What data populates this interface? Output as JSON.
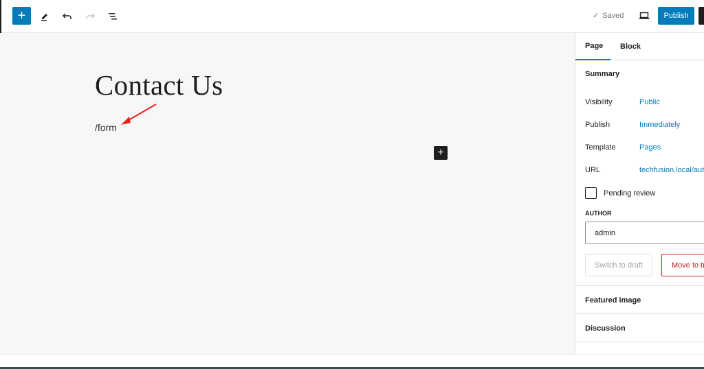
{
  "toolbar": {
    "inserter_icon": "plus-icon",
    "tools_icon": "pencil-icon",
    "undo_icon": "undo-icon",
    "redo_icon": "redo-icon",
    "outline_icon": "list-view-icon",
    "saved_label": "Saved",
    "preview_icon": "desktop-icon",
    "publish_label": "Publish"
  },
  "editor": {
    "title": "Contact Us",
    "paragraph": "/form",
    "annotation": "red-arrow",
    "block_add_icon": "plus-icon"
  },
  "sidebar": {
    "tabs": [
      {
        "label": "Page",
        "active": true
      },
      {
        "label": "Block",
        "active": false
      }
    ],
    "summary": {
      "title": "Summary",
      "rows": [
        {
          "label": "Visibility",
          "value": "Public"
        },
        {
          "label": "Publish",
          "value": "Immediately"
        },
        {
          "label": "Template",
          "value": "Pages"
        },
        {
          "label": "URL",
          "value": "techfusion.local/auto"
        }
      ],
      "pending_review": {
        "label": "Pending review",
        "checked": false
      },
      "author": {
        "label": "AUTHOR",
        "value": "admin"
      },
      "switch_to_draft": "Switch to draft",
      "move_to_trash": "Move to trash"
    },
    "panels": [
      {
        "title": "Featured image"
      },
      {
        "title": "Discussion"
      }
    ]
  },
  "colors": {
    "accent": "#007cba",
    "danger": "#cc1818",
    "annotation": "#e8201a"
  }
}
